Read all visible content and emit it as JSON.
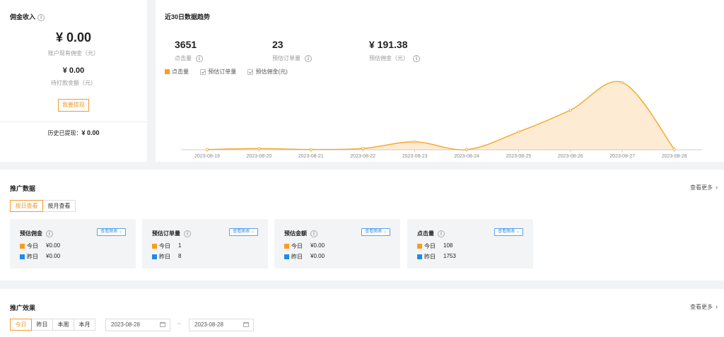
{
  "commission": {
    "title": "佣金收入",
    "balance": "¥ 0.00",
    "balance_label": "账户现有佣金（元）",
    "pending": "¥ 0.00",
    "pending_label": "待打款金额（元）",
    "withdraw_button": "我要提现",
    "history_label": "历史已提现：",
    "history_value": "¥ 0.00"
  },
  "trend": {
    "title": "近30日数据趋势",
    "metrics": [
      {
        "value": "3651",
        "label": "点击量"
      },
      {
        "value": "23",
        "label": "预估订单量"
      },
      {
        "value": "¥ 191.38",
        "label": "预估佣金（元）"
      }
    ],
    "legend": [
      {
        "label": "点击量",
        "active": true
      },
      {
        "label": "预估订单量",
        "active": false
      },
      {
        "label": "预估佣金(元)",
        "active": false
      }
    ],
    "colors": {
      "line": "#f5a623",
      "fill": "#fdebd4"
    }
  },
  "chart_data": {
    "type": "area",
    "x": [
      "2023-08-19",
      "2023-08-20",
      "2023-08-21",
      "2023-08-22",
      "2023-08-23",
      "2023-08-24",
      "2023-08-25",
      "2023-08-26",
      "2023-08-27",
      "2023-08-28"
    ],
    "series": [
      {
        "name": "点击量",
        "values": [
          10,
          40,
          10,
          45,
          270,
          5,
          610,
          1350,
          2290,
          20
        ]
      }
    ],
    "ylim": [
      0,
      2500
    ],
    "grid": false
  },
  "promo_data": {
    "title": "推广数据",
    "more": "查看更多",
    "tabs": [
      "按日查看",
      "按月查看"
    ],
    "chart_button": "查看图表",
    "today_label": "今日",
    "yesterday_label": "昨日",
    "stats": [
      {
        "title": "预估佣金",
        "today": "¥0.00",
        "yesterday": "¥0.00"
      },
      {
        "title": "预估订单量",
        "today": "1",
        "yesterday": "8"
      },
      {
        "title": "预估金额",
        "today": "¥0.00",
        "yesterday": "¥0.00"
      },
      {
        "title": "点击量",
        "today": "108",
        "yesterday": "1753"
      }
    ]
  },
  "promo_effect": {
    "title": "推广效果",
    "more": "查看更多",
    "tabs": [
      "今日",
      "昨日",
      "本周",
      "本月"
    ],
    "start_date": "2023-08-28",
    "end_date": "2023-08-28",
    "separator": "~"
  }
}
